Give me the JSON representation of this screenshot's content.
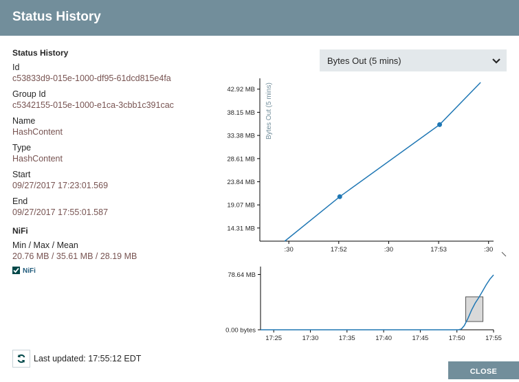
{
  "dialog": {
    "title": "Status History",
    "close_label": "CLOSE"
  },
  "details": {
    "section_title": "Status History",
    "fields": [
      {
        "label": "Id",
        "value": "c53833d9-015e-1000-df95-61dcd815e4fa"
      },
      {
        "label": "Group Id",
        "value": "c5342155-015e-1000-e1ca-3cbb1c391cac"
      },
      {
        "label": "Name",
        "value": "HashContent"
      },
      {
        "label": "Type",
        "value": "HashContent"
      },
      {
        "label": "Start",
        "value": "09/27/2017 17:23:01.569"
      },
      {
        "label": "End",
        "value": "09/27/2017 17:55:01.587"
      }
    ],
    "nifi_title": "NiFi",
    "minmax_label": "Min / Max / Mean",
    "minmax_value": "20.76 MB / 35.61 MB / 28.19 MB",
    "legend_label": "NiFi"
  },
  "metric_select": {
    "value": "Bytes Out (5 mins)"
  },
  "footer": {
    "last_updated_label": "Last updated:",
    "last_updated_time": "17:55:12 EDT"
  },
  "colors": {
    "header": "#728e9b",
    "line": "#1f77b4",
    "value_text": "#775351"
  },
  "chart_data": [
    {
      "type": "line",
      "ylabel": "Bytes Out (5 mins)",
      "y_ticks": [
        "42.92 MB",
        "38.15 MB",
        "33.38 MB",
        "28.61 MB",
        "23.84 MB",
        "19.07 MB",
        "14.31 MB"
      ],
      "y_tick_values": [
        42.92,
        38.15,
        33.38,
        28.61,
        23.84,
        19.07,
        14.31
      ],
      "x_ticks": [
        ":30",
        "17:52",
        ":30",
        "17:53",
        ":30"
      ],
      "x_tick_values": [
        51.5,
        52.0,
        52.5,
        53.0,
        53.5
      ],
      "xlim": [
        51.21,
        53.55
      ],
      "ylim": [
        11.6,
        44.3
      ],
      "series": [
        {
          "x": [
            51.46,
            52.01,
            53.01,
            53.42
          ],
          "y": [
            11.6,
            20.76,
            35.61,
            44.3
          ],
          "markers": [
            1,
            2
          ]
        }
      ]
    },
    {
      "type": "line",
      "y_ticks": [
        "78.64 MB",
        "0.00 bytes"
      ],
      "y_tick_values": [
        78.64,
        0
      ],
      "x_ticks": [
        "17:25",
        "17:30",
        "17:35",
        "17:40",
        "17:45",
        "17:50",
        "17:55"
      ],
      "x_tick_values": [
        25,
        30,
        35,
        40,
        45,
        50,
        55
      ],
      "xlim": [
        23.2,
        55.0
      ],
      "ylim": [
        0,
        84
      ],
      "brush": [
        51.2,
        53.55
      ],
      "series": [
        {
          "x": [
            23.2,
            50.2,
            50.6,
            51.0,
            51.5,
            52.0,
            52.5,
            53.0,
            53.5,
            54.0,
            54.5,
            55.0
          ],
          "y": [
            0,
            0,
            1,
            6,
            16,
            28,
            38,
            46,
            55,
            64,
            72,
            78
          ]
        }
      ]
    }
  ]
}
